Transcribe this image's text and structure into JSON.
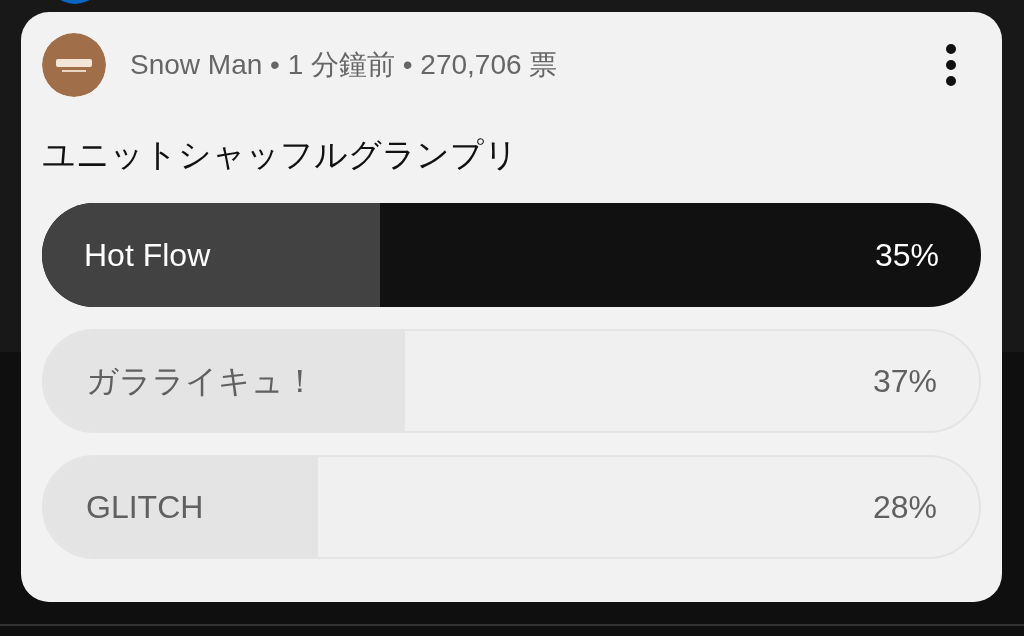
{
  "post": {
    "meta": "Snow Man • 1 分鐘前 • 270,706 票",
    "question": "ユニットシャッフルグランプリ"
  },
  "options": [
    {
      "label": "Hot Flow",
      "percent": "35%",
      "level": 0.36,
      "selected": true
    },
    {
      "label": "ガラライキュ！",
      "percent": "37%",
      "level": 0.386,
      "selected": false
    },
    {
      "label": "GLITCH",
      "percent": "28%",
      "level": 0.293,
      "selected": false
    }
  ]
}
